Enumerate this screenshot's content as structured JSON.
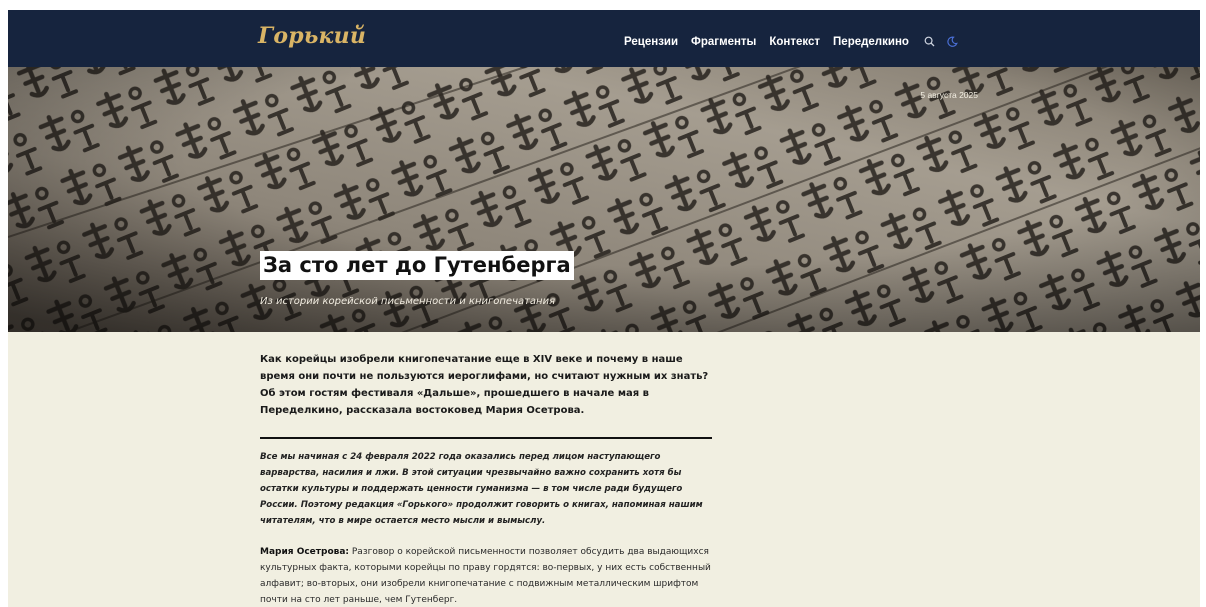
{
  "header": {
    "logo": "Горький",
    "nav": [
      "Рецензии",
      "Фрагменты",
      "Контекст",
      "Переделкино"
    ],
    "icons": [
      "search-icon",
      "moon-icon"
    ],
    "colors": {
      "bar": "#16243e",
      "logo": "#d9b465",
      "search_icon": "#cfd5e0",
      "moon_icon": "#4a6fd6"
    }
  },
  "hero": {
    "date": "5 августа 2025",
    "title": "За сто лет до Гутенберга",
    "subtitle": "Из истории корейской письменности и книгопечатания"
  },
  "article": {
    "lead": "Как корейцы изобрели книгопечатание еще в XIV веке и почему в наше время они почти не пользуются иероглифами, но считают нужным их знать? Об этом гостям фестиваля «Дальше», прошедшего в начале мая в Переделкино, рассказала востоковед Мария Осетрова.",
    "notice": "Все мы начиная с 24 февраля 2022 года оказались перед лицом наступающего варварства, насилия и лжи. В этой ситуации чрезвычайно важно сохранить хотя бы остатки культуры и поддержать ценности гуманизма — в том числе ради будущего России. Поэтому редакция «Горького» продолжит говорить о книгах, напоминая нашим читателям, что в мире остается место мысли и вымыслу.",
    "speaker": "Мария Осетрова:",
    "paragraph": "Разговор о корейской письменности позволяет обсудить два выдающихся культурных факта, которыми корейцы по праву гордятся: во-первых, у них есть собственный алфавит; во-вторых, они изобрели книгопечатание с подвижным металлическим шрифтом почти на сто лет раньше, чем Гутенберг."
  },
  "colors": {
    "page_bg": "#f1efe1",
    "title_bg": "#ffffff"
  }
}
